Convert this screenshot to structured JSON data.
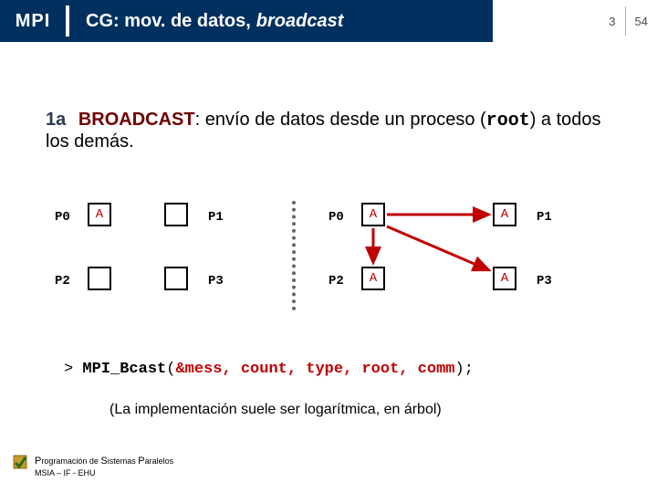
{
  "header": {
    "mpi": "MPI",
    "title_a": "CG: mov. de datos,",
    "title_b": "broadcast",
    "page_cur": "3",
    "page_total": "54"
  },
  "section": {
    "tag": "1a",
    "kw": "BROADCAST",
    "rest_a": ": envío de datos desde un proceso (",
    "root": "root",
    "rest_b": ") a todos los demás."
  },
  "diagram": {
    "P0": "P0",
    "P1": "P1",
    "P2": "P2",
    "P3": "P3",
    "A": "A"
  },
  "code": {
    "gt": ">",
    "fn": "MPI_Bcast",
    "open": "(",
    "args": "&mess, count, type, root, comm",
    "close": ");"
  },
  "note": "(La implementación suele ser logarítmica, en árbol)",
  "footer": {
    "l1_a": "P",
    "l1_b": "rogramación de ",
    "l1_c": "S",
    "l1_d": "istemas ",
    "l1_e": "P",
    "l1_f": "aralelos",
    "l2": "MSIA – IF - EHU"
  }
}
